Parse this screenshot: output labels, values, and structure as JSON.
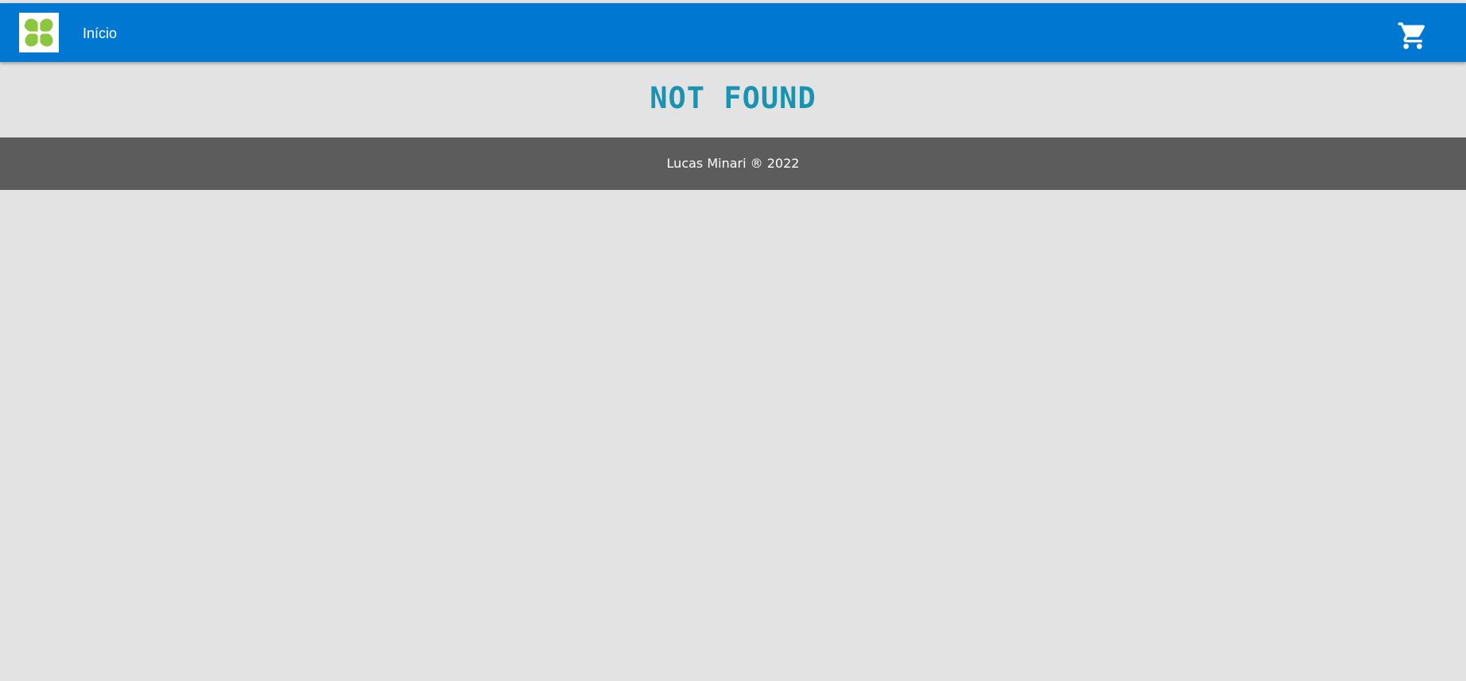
{
  "header": {
    "logo_icon": "clover-logo-icon",
    "nav_home_label": "Início",
    "cart_icon": "shopping-cart-icon"
  },
  "main": {
    "title": "NOT FOUND"
  },
  "footer": {
    "text": "Lucas Minari ® 2022"
  },
  "colors": {
    "header_bg": "#0077d0",
    "page_bg": "#e3e3e3",
    "title_color": "#1a93b0",
    "footer_bg": "#5c5c5c",
    "logo_green": "#8cc63f"
  }
}
